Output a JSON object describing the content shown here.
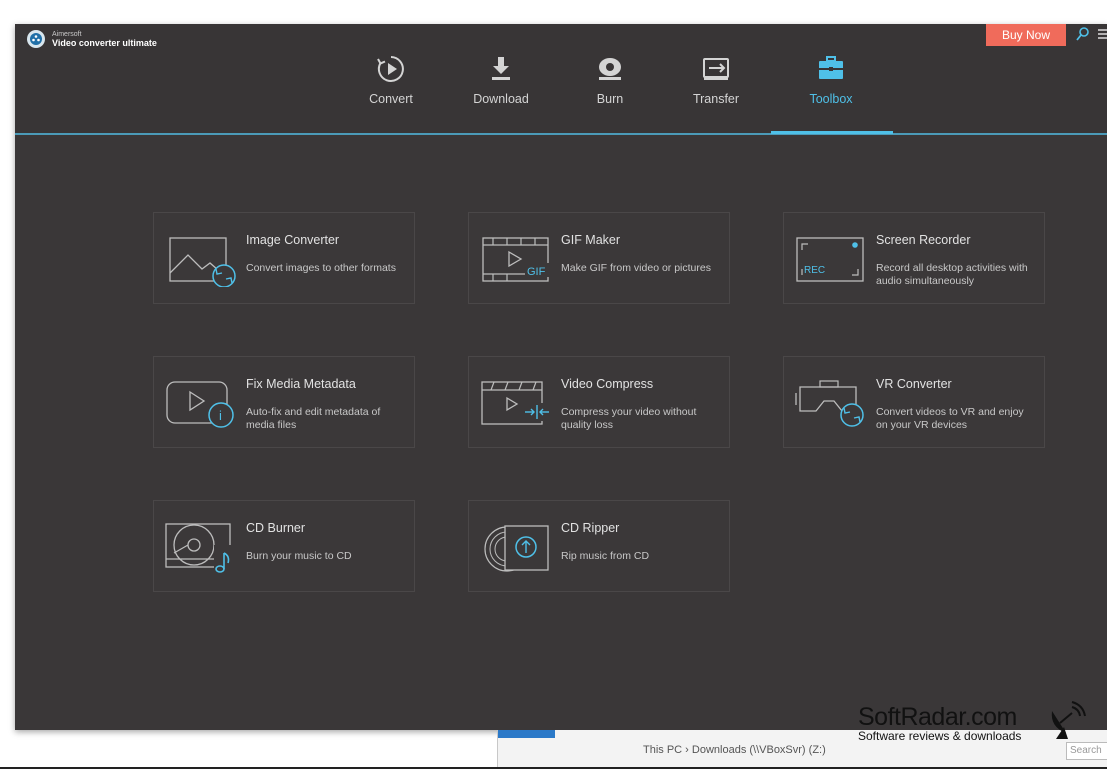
{
  "app": {
    "brand": "Aimersoft",
    "product": "Video converter ultimate",
    "buy_label": "Buy Now"
  },
  "tabs": [
    {
      "label": "Convert",
      "icon": "convert-icon"
    },
    {
      "label": "Download",
      "icon": "download-icon"
    },
    {
      "label": "Burn",
      "icon": "burn-icon"
    },
    {
      "label": "Transfer",
      "icon": "transfer-icon"
    },
    {
      "label": "Toolbox",
      "icon": "toolbox-icon",
      "active": true
    }
  ],
  "tools": [
    {
      "title": "Image Converter",
      "desc": "Convert images to other formats",
      "icon": "image-convert-icon"
    },
    {
      "title": "GIF Maker",
      "desc": "Make GIF from video or pictures",
      "icon": "gif-maker-icon"
    },
    {
      "title": "Screen Recorder",
      "desc": "Record all desktop activities with audio simultaneously",
      "icon": "screen-recorder-icon"
    },
    {
      "title": "Fix Media Metadata",
      "desc": "Auto-fix and edit metadata of media files",
      "icon": "metadata-icon"
    },
    {
      "title": "Video Compress",
      "desc": "Compress your video without quality loss",
      "icon": "video-compress-icon"
    },
    {
      "title": "VR Converter",
      "desc": "Convert videos to VR and enjoy on your VR devices",
      "icon": "vr-icon"
    },
    {
      "title": "CD Burner",
      "desc": "Burn your music to CD",
      "icon": "cd-burner-icon"
    },
    {
      "title": "CD Ripper",
      "desc": "Rip music from CD",
      "icon": "cd-ripper-icon"
    }
  ],
  "icon_text": {
    "gif": "GIF",
    "rec": "REC",
    "info": "i"
  },
  "background_window": {
    "path": "This PC  ›  Downloads (\\\\VBoxSvr) (Z:)",
    "search": "Search"
  },
  "watermark": {
    "name": "SoftRadar.com",
    "tagline": "Software reviews & downloads"
  },
  "colors": {
    "accent": "#4fc0e8",
    "buy": "#f06b5b",
    "background": "#3a3738",
    "card": "#3b3839"
  }
}
